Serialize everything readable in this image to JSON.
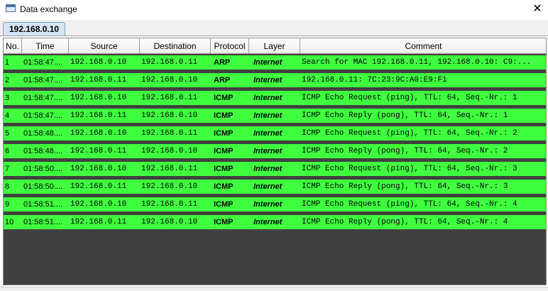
{
  "window": {
    "title": "Data exchange",
    "close_label": "✕"
  },
  "tabs": [
    {
      "label": "192.168.0.10"
    }
  ],
  "table": {
    "columns": [
      "No.",
      "Time",
      "Source",
      "Destination",
      "Protocol",
      "Layer",
      "Comment"
    ],
    "rows": [
      {
        "no": "1",
        "time": "01:58:47....",
        "source": "192.168.0.10",
        "destination": "192.168.0.11",
        "protocol": "ARP",
        "layer": "Internet",
        "comment": "Search for MAC 192.168.0.11, 192.168.0.10: C9:..."
      },
      {
        "no": "2",
        "time": "01:58:47....",
        "source": "192.168.0.11",
        "destination": "192.168.0.10",
        "protocol": "ARP",
        "layer": "Internet",
        "comment": "192.168.0.11: 7C:23:9C:A0:E9:F1"
      },
      {
        "no": "3",
        "time": "01:58:47....",
        "source": "192.168.0.10",
        "destination": "192.168.0.11",
        "protocol": "ICMP",
        "layer": "Internet",
        "comment": "ICMP Echo Request (ping), TTL: 64, Seq.-Nr.: 1"
      },
      {
        "no": "4",
        "time": "01:58:47....",
        "source": "192.168.0.11",
        "destination": "192.168.0.10",
        "protocol": "ICMP",
        "layer": "Internet",
        "comment": "ICMP Echo Reply (pong), TTL: 64, Seq.-Nr.: 1"
      },
      {
        "no": "5",
        "time": "01:58:48....",
        "source": "192.168.0.10",
        "destination": "192.168.0.11",
        "protocol": "ICMP",
        "layer": "Internet",
        "comment": "ICMP Echo Request (ping), TTL: 64, Seq.-Nr.: 2"
      },
      {
        "no": "6",
        "time": "01:58:48....",
        "source": "192.168.0.11",
        "destination": "192.168.0.10",
        "protocol": "ICMP",
        "layer": "Internet",
        "comment": "ICMP Echo Reply (pong), TTL: 64, Seq.-Nr.: 2"
      },
      {
        "no": "7",
        "time": "01:58:50....",
        "source": "192.168.0.10",
        "destination": "192.168.0.11",
        "protocol": "ICMP",
        "layer": "Internet",
        "comment": "ICMP Echo Request (ping), TTL: 64, Seq.-Nr.: 3"
      },
      {
        "no": "8",
        "time": "01:58:50....",
        "source": "192.168.0.11",
        "destination": "192.168.0.10",
        "protocol": "ICMP",
        "layer": "Internet",
        "comment": "ICMP Echo Reply (pong), TTL: 64, Seq.-Nr.: 3"
      },
      {
        "no": "9",
        "time": "01:58:51....",
        "source": "192.168.0.10",
        "destination": "192.168.0.11",
        "protocol": "ICMP",
        "layer": "Internet",
        "comment": "ICMP Echo Request (ping), TTL: 64, Seq.-Nr.: 4"
      },
      {
        "no": "10",
        "time": "01:58:51....",
        "source": "192.168.0.11",
        "destination": "192.168.0.10",
        "protocol": "ICMP",
        "layer": "Internet",
        "comment": "ICMP Echo Reply (pong), TTL: 64, Seq.-Nr.: 4"
      }
    ]
  },
  "colors": {
    "row_bg": "#3fff3f",
    "empty_bg": "#404040",
    "tab_bg": "#d5e3f5"
  }
}
